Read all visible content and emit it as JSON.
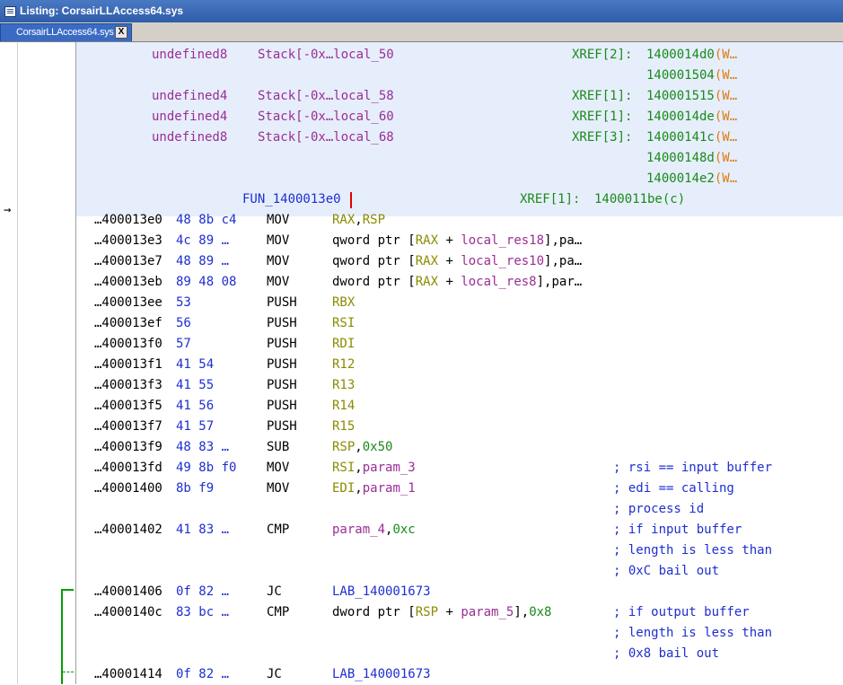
{
  "window": {
    "title": "Listing:  CorsairLLAccess64.sys"
  },
  "tab": {
    "label": "CorsairLLAccess64.sys",
    "close": "X"
  },
  "icons": {
    "window_icon": "listing-icon",
    "cursor": "arrow-right-icon",
    "close": "close-icon"
  },
  "colors": {
    "header_bg": "#e6eefb",
    "flow_arrow": "#00a000",
    "titlebar": "#2f5ca8"
  },
  "stack_vars": [
    {
      "type": "undefined8",
      "stack": "Stack[-0x…local_50",
      "xref": "XREF[2]:",
      "refs": [
        "1400014d0",
        "140001504"
      ]
    },
    {
      "type": "undefined4",
      "stack": "Stack[-0x…local_58",
      "xref": "XREF[1]:",
      "refs": [
        "140001515"
      ]
    },
    {
      "type": "undefined4",
      "stack": "Stack[-0x…local_60",
      "xref": "XREF[1]:",
      "refs": [
        "1400014de"
      ]
    },
    {
      "type": "undefined8",
      "stack": "Stack[-0x…local_68",
      "xref": "XREF[3]:",
      "refs": [
        "14000141c",
        "14000148d",
        "1400014e2"
      ]
    }
  ],
  "ref_suffix": {
    "open": "(",
    "w": "W",
    "ell": "…"
  },
  "function": {
    "name": "FUN_1400013e0",
    "xref": "XREF[1]:",
    "ref": "1400011be(c)"
  },
  "instructions": [
    {
      "addr": "…400013e0",
      "bytes": "48 8b c4",
      "mnem": "MOV",
      "ops": [
        [
          "RAX",
          "olive"
        ],
        [
          ",",
          "black"
        ],
        [
          "RSP",
          "olive"
        ]
      ],
      "comment": []
    },
    {
      "addr": "…400013e3",
      "bytes": "4c 89 …",
      "mnem": "MOV",
      "ops": [
        [
          "qword ptr [",
          "black"
        ],
        [
          "RAX",
          "olive"
        ],
        [
          " + ",
          "black"
        ],
        [
          "local_res18",
          "purple"
        ],
        [
          "],pa…",
          "black"
        ]
      ],
      "comment": []
    },
    {
      "addr": "…400013e7",
      "bytes": "48 89 …",
      "mnem": "MOV",
      "ops": [
        [
          "qword ptr [",
          "black"
        ],
        [
          "RAX",
          "olive"
        ],
        [
          " + ",
          "black"
        ],
        [
          "local_res10",
          "purple"
        ],
        [
          "],pa…",
          "black"
        ]
      ],
      "comment": []
    },
    {
      "addr": "…400013eb",
      "bytes": "89 48 08",
      "mnem": "MOV",
      "ops": [
        [
          "dword ptr [",
          "black"
        ],
        [
          "RAX",
          "olive"
        ],
        [
          " + ",
          "black"
        ],
        [
          "local_res8",
          "purple"
        ],
        [
          "],par…",
          "black"
        ]
      ],
      "comment": []
    },
    {
      "addr": "…400013ee",
      "bytes": "53",
      "mnem": "PUSH",
      "ops": [
        [
          "RBX",
          "olive"
        ]
      ],
      "comment": []
    },
    {
      "addr": "…400013ef",
      "bytes": "56",
      "mnem": "PUSH",
      "ops": [
        [
          "RSI",
          "olive"
        ]
      ],
      "comment": []
    },
    {
      "addr": "…400013f0",
      "bytes": "57",
      "mnem": "PUSH",
      "ops": [
        [
          "RDI",
          "olive"
        ]
      ],
      "comment": []
    },
    {
      "addr": "…400013f1",
      "bytes": "41 54",
      "mnem": "PUSH",
      "ops": [
        [
          "R12",
          "olive"
        ]
      ],
      "comment": []
    },
    {
      "addr": "…400013f3",
      "bytes": "41 55",
      "mnem": "PUSH",
      "ops": [
        [
          "R13",
          "olive"
        ]
      ],
      "comment": []
    },
    {
      "addr": "…400013f5",
      "bytes": "41 56",
      "mnem": "PUSH",
      "ops": [
        [
          "R14",
          "olive"
        ]
      ],
      "comment": []
    },
    {
      "addr": "…400013f7",
      "bytes": "41 57",
      "mnem": "PUSH",
      "ops": [
        [
          "R15",
          "olive"
        ]
      ],
      "comment": []
    },
    {
      "addr": "…400013f9",
      "bytes": "48 83 …",
      "mnem": "SUB",
      "ops": [
        [
          "RSP",
          "olive"
        ],
        [
          ",",
          "black"
        ],
        [
          "0x50",
          "green"
        ]
      ],
      "comment": []
    },
    {
      "addr": "…400013fd",
      "bytes": "49 8b f0",
      "mnem": "MOV",
      "ops": [
        [
          "RSI",
          "olive"
        ],
        [
          ",",
          "black"
        ],
        [
          "param_3",
          "purple"
        ]
      ],
      "comment": [
        "; rsi == input buffer"
      ]
    },
    {
      "addr": "…40001400",
      "bytes": "8b f9",
      "mnem": "MOV",
      "ops": [
        [
          "EDI",
          "olive"
        ],
        [
          ",",
          "black"
        ],
        [
          "param_1",
          "purple"
        ]
      ],
      "comment": [
        "; edi == calling",
        "; process id"
      ]
    },
    {
      "addr": "…40001402",
      "bytes": "41 83 …",
      "mnem": "CMP",
      "ops": [
        [
          "param_4",
          "purple"
        ],
        [
          ",",
          "black"
        ],
        [
          "0xc",
          "green"
        ]
      ],
      "comment": [
        "; if input buffer",
        "; length is less than",
        "; 0xC bail out"
      ]
    },
    {
      "addr": "…40001406",
      "bytes": "0f 82 …",
      "mnem": "JC",
      "ops": [
        [
          "LAB_140001673",
          "blue"
        ]
      ],
      "comment": []
    },
    {
      "addr": "…4000140c",
      "bytes": "83 bc …",
      "mnem": "CMP",
      "ops": [
        [
          "dword ptr [",
          "black"
        ],
        [
          "RSP",
          "olive"
        ],
        [
          " + ",
          "black"
        ],
        [
          "param_5",
          "purple"
        ],
        [
          "],",
          "black"
        ],
        [
          "0x8",
          "green"
        ]
      ],
      "comment": [
        "; if output buffer",
        "; length is less than",
        "; 0x8 bail out"
      ]
    },
    {
      "addr": "…40001414",
      "bytes": "0f 82 …",
      "mnem": "JC",
      "ops": [
        [
          "LAB_140001673",
          "blue"
        ]
      ],
      "comment": []
    }
  ]
}
